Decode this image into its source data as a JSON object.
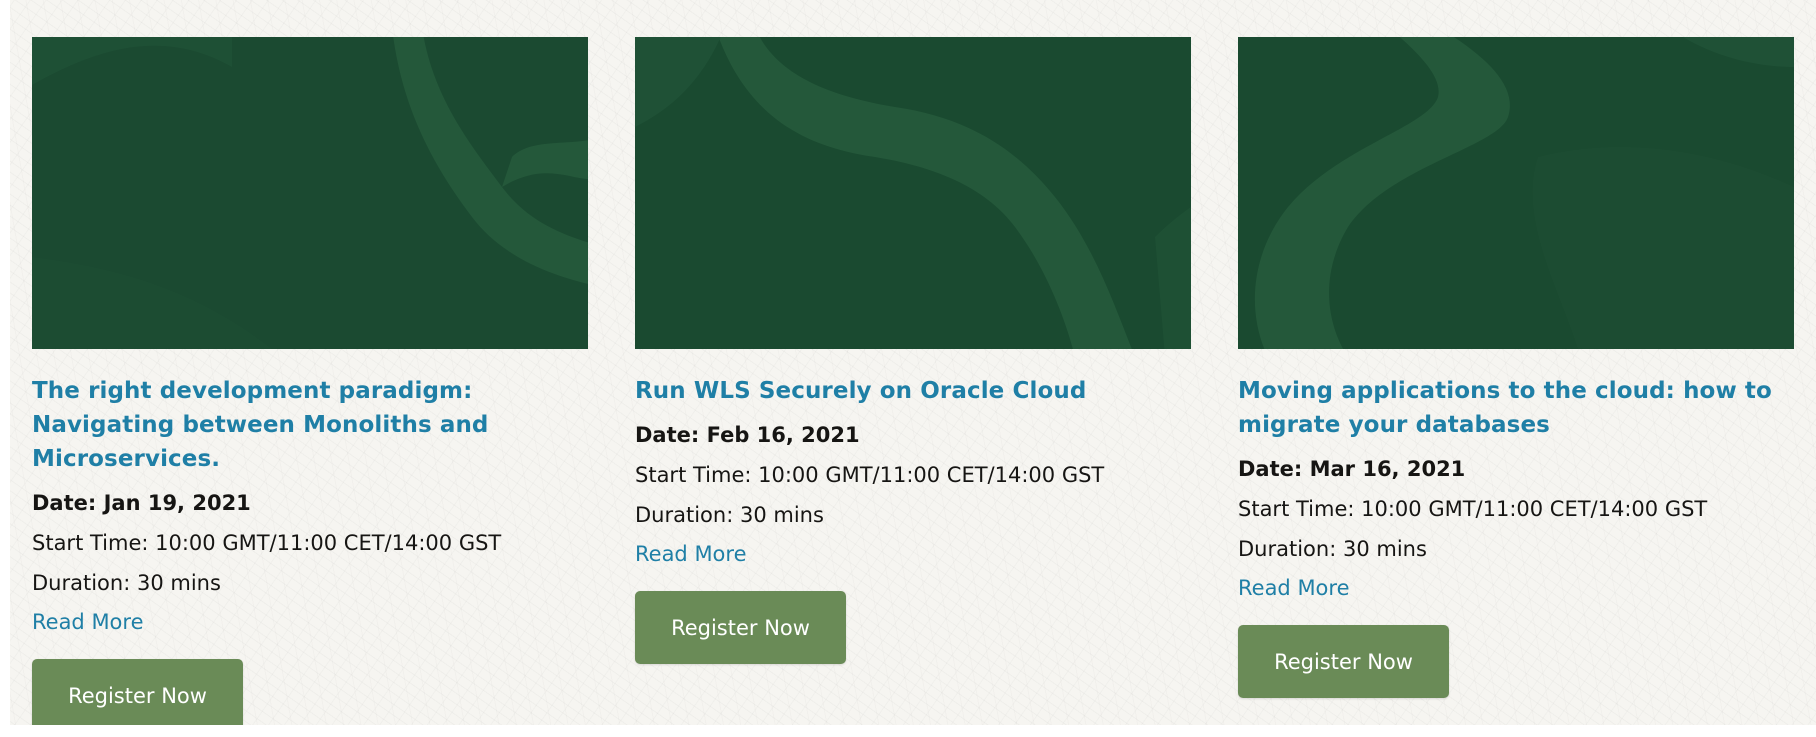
{
  "events": [
    {
      "title": "The right development paradigm: Navigating between Monoliths and Microservices.",
      "date": "Date: Jan 19, 2021",
      "start_time": "Start Time: 10:00 GMT/11:00 CET/14:00 GST",
      "duration": "Duration: 30 mins",
      "read_more": "Read More",
      "register": "Register Now"
    },
    {
      "title": "Run WLS Securely on Oracle Cloud",
      "date": "Date: Feb 16, 2021",
      "start_time": "Start Time: 10:00 GMT/11:00 CET/14:00 GST",
      "duration": "Duration: 30 mins",
      "read_more": "Read More",
      "register": "Register Now"
    },
    {
      "title": "Moving applications to the cloud: how to migrate your databases",
      "date": "Date: Mar 16, 2021",
      "start_time": "Start Time: 10:00 GMT/11:00 CET/14:00 GST",
      "duration": "Duration: 30 mins",
      "read_more": "Read More",
      "register": "Register Now"
    }
  ],
  "colors": {
    "image_background": "#1a4a30",
    "image_shape": "#24583a",
    "title_link": "#1f7fa6",
    "button": "#6a8b57",
    "page_background": "#f6f5f1"
  }
}
